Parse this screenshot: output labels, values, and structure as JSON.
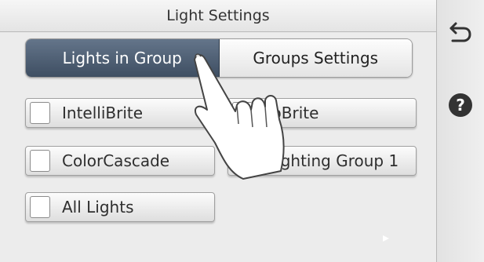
{
  "header": {
    "title": "Light Settings"
  },
  "tabs": [
    {
      "label": "Lights in Group",
      "active": true
    },
    {
      "label": "Groups Settings",
      "active": false
    }
  ],
  "items": [
    {
      "label": "IntelliBrite",
      "checked": false
    },
    {
      "label": "loBrite",
      "checked": false
    },
    {
      "label": "ColorCascade",
      "checked": false
    },
    {
      "label": "Lighting Group 1",
      "checked": false
    },
    {
      "label": "All Lights",
      "checked": false
    }
  ],
  "sidebar": {
    "back_icon": "back-arrow-icon",
    "help_icon": "help-icon",
    "help_glyph": "?"
  },
  "colors": {
    "active_tab": "#4f5f73",
    "background": "#ececec"
  }
}
